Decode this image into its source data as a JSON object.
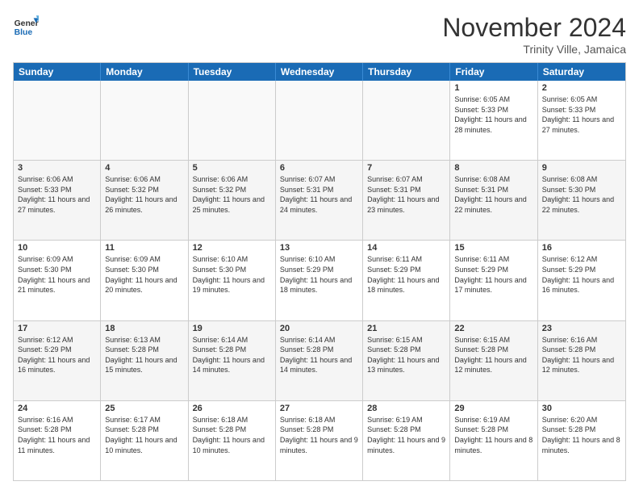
{
  "header": {
    "logo_general": "General",
    "logo_blue": "Blue",
    "month_title": "November 2024",
    "location": "Trinity Ville, Jamaica"
  },
  "weekdays": [
    "Sunday",
    "Monday",
    "Tuesday",
    "Wednesday",
    "Thursday",
    "Friday",
    "Saturday"
  ],
  "rows": [
    [
      {
        "day": "",
        "text": "",
        "empty": true
      },
      {
        "day": "",
        "text": "",
        "empty": true
      },
      {
        "day": "",
        "text": "",
        "empty": true
      },
      {
        "day": "",
        "text": "",
        "empty": true
      },
      {
        "day": "",
        "text": "",
        "empty": true
      },
      {
        "day": "1",
        "text": "Sunrise: 6:05 AM\nSunset: 5:33 PM\nDaylight: 11 hours and 28 minutes."
      },
      {
        "day": "2",
        "text": "Sunrise: 6:05 AM\nSunset: 5:33 PM\nDaylight: 11 hours and 27 minutes."
      }
    ],
    [
      {
        "day": "3",
        "text": "Sunrise: 6:06 AM\nSunset: 5:33 PM\nDaylight: 11 hours and 27 minutes.",
        "alt": true
      },
      {
        "day": "4",
        "text": "Sunrise: 6:06 AM\nSunset: 5:32 PM\nDaylight: 11 hours and 26 minutes.",
        "alt": true
      },
      {
        "day": "5",
        "text": "Sunrise: 6:06 AM\nSunset: 5:32 PM\nDaylight: 11 hours and 25 minutes.",
        "alt": true
      },
      {
        "day": "6",
        "text": "Sunrise: 6:07 AM\nSunset: 5:31 PM\nDaylight: 11 hours and 24 minutes.",
        "alt": true
      },
      {
        "day": "7",
        "text": "Sunrise: 6:07 AM\nSunset: 5:31 PM\nDaylight: 11 hours and 23 minutes.",
        "alt": true
      },
      {
        "day": "8",
        "text": "Sunrise: 6:08 AM\nSunset: 5:31 PM\nDaylight: 11 hours and 22 minutes.",
        "alt": true
      },
      {
        "day": "9",
        "text": "Sunrise: 6:08 AM\nSunset: 5:30 PM\nDaylight: 11 hours and 22 minutes.",
        "alt": true
      }
    ],
    [
      {
        "day": "10",
        "text": "Sunrise: 6:09 AM\nSunset: 5:30 PM\nDaylight: 11 hours and 21 minutes."
      },
      {
        "day": "11",
        "text": "Sunrise: 6:09 AM\nSunset: 5:30 PM\nDaylight: 11 hours and 20 minutes."
      },
      {
        "day": "12",
        "text": "Sunrise: 6:10 AM\nSunset: 5:30 PM\nDaylight: 11 hours and 19 minutes."
      },
      {
        "day": "13",
        "text": "Sunrise: 6:10 AM\nSunset: 5:29 PM\nDaylight: 11 hours and 18 minutes."
      },
      {
        "day": "14",
        "text": "Sunrise: 6:11 AM\nSunset: 5:29 PM\nDaylight: 11 hours and 18 minutes."
      },
      {
        "day": "15",
        "text": "Sunrise: 6:11 AM\nSunset: 5:29 PM\nDaylight: 11 hours and 17 minutes."
      },
      {
        "day": "16",
        "text": "Sunrise: 6:12 AM\nSunset: 5:29 PM\nDaylight: 11 hours and 16 minutes."
      }
    ],
    [
      {
        "day": "17",
        "text": "Sunrise: 6:12 AM\nSunset: 5:29 PM\nDaylight: 11 hours and 16 minutes.",
        "alt": true
      },
      {
        "day": "18",
        "text": "Sunrise: 6:13 AM\nSunset: 5:28 PM\nDaylight: 11 hours and 15 minutes.",
        "alt": true
      },
      {
        "day": "19",
        "text": "Sunrise: 6:14 AM\nSunset: 5:28 PM\nDaylight: 11 hours and 14 minutes.",
        "alt": true
      },
      {
        "day": "20",
        "text": "Sunrise: 6:14 AM\nSunset: 5:28 PM\nDaylight: 11 hours and 14 minutes.",
        "alt": true
      },
      {
        "day": "21",
        "text": "Sunrise: 6:15 AM\nSunset: 5:28 PM\nDaylight: 11 hours and 13 minutes.",
        "alt": true
      },
      {
        "day": "22",
        "text": "Sunrise: 6:15 AM\nSunset: 5:28 PM\nDaylight: 11 hours and 12 minutes.",
        "alt": true
      },
      {
        "day": "23",
        "text": "Sunrise: 6:16 AM\nSunset: 5:28 PM\nDaylight: 11 hours and 12 minutes.",
        "alt": true
      }
    ],
    [
      {
        "day": "24",
        "text": "Sunrise: 6:16 AM\nSunset: 5:28 PM\nDaylight: 11 hours and 11 minutes."
      },
      {
        "day": "25",
        "text": "Sunrise: 6:17 AM\nSunset: 5:28 PM\nDaylight: 11 hours and 10 minutes."
      },
      {
        "day": "26",
        "text": "Sunrise: 6:18 AM\nSunset: 5:28 PM\nDaylight: 11 hours and 10 minutes."
      },
      {
        "day": "27",
        "text": "Sunrise: 6:18 AM\nSunset: 5:28 PM\nDaylight: 11 hours and 9 minutes."
      },
      {
        "day": "28",
        "text": "Sunrise: 6:19 AM\nSunset: 5:28 PM\nDaylight: 11 hours and 9 minutes."
      },
      {
        "day": "29",
        "text": "Sunrise: 6:19 AM\nSunset: 5:28 PM\nDaylight: 11 hours and 8 minutes."
      },
      {
        "day": "30",
        "text": "Sunrise: 6:20 AM\nSunset: 5:28 PM\nDaylight: 11 hours and 8 minutes."
      }
    ]
  ]
}
